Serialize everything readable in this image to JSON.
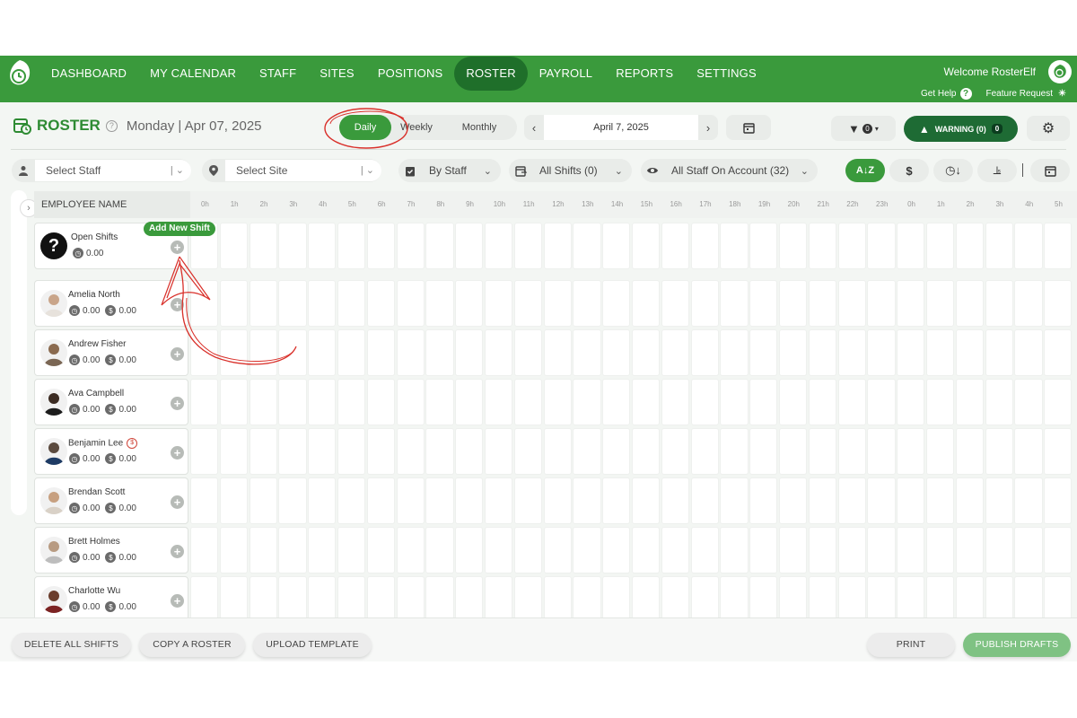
{
  "nav": {
    "items": [
      "DASHBOARD",
      "MY CALENDAR",
      "STAFF",
      "SITES",
      "POSITIONS",
      "ROSTER",
      "PAYROLL",
      "REPORTS",
      "SETTINGS"
    ],
    "active": "ROSTER",
    "welcome": "Welcome RosterElf",
    "get_help": "Get Help",
    "feature_request": "Feature Request"
  },
  "header": {
    "title": "ROSTER",
    "date": "Monday | Apr 07, 2025",
    "views": [
      "Daily",
      "Weekly",
      "Monthly"
    ],
    "active_view": "Daily",
    "selected_date": "April 7, 2025",
    "filter_count": "0",
    "warning_label": "WARNING (0)",
    "warning_count": "0"
  },
  "filters": {
    "staff_placeholder": "Select Staff",
    "site_placeholder": "Select Site",
    "group_by": "By Staff",
    "shifts": "All Shifts (0)",
    "visibility": "All Staff On Account (32)"
  },
  "grid": {
    "employee_header": "EMPLOYEE NAME",
    "hours": [
      "0h",
      "1h",
      "2h",
      "3h",
      "4h",
      "5h",
      "6h",
      "7h",
      "8h",
      "9h",
      "10h",
      "11h",
      "12h",
      "13h",
      "14h",
      "15h",
      "16h",
      "17h",
      "18h",
      "19h",
      "20h",
      "21h",
      "22h",
      "23h",
      "0h",
      "1h",
      "2h",
      "3h",
      "4h",
      "5h"
    ],
    "add_new_shift": "Add New Shift",
    "open_shifts": {
      "name": "Open Shifts",
      "hours": "0.00"
    },
    "employees": [
      {
        "name": "Amelia North",
        "hours": "0.00",
        "cost": "0.00"
      },
      {
        "name": "Andrew Fisher",
        "hours": "0.00",
        "cost": "0.00"
      },
      {
        "name": "Ava Campbell",
        "hours": "0.00",
        "cost": "0.00"
      },
      {
        "name": "Benjamin Lee",
        "hours": "0.00",
        "cost": "0.00"
      },
      {
        "name": "Brendan Scott",
        "hours": "0.00",
        "cost": "0.00"
      },
      {
        "name": "Brett Holmes",
        "hours": "0.00",
        "cost": "0.00"
      },
      {
        "name": "Charlotte Wu",
        "hours": "0.00",
        "cost": "0.00"
      }
    ]
  },
  "bottom": {
    "delete_all": "DELETE ALL SHIFTS",
    "copy": "COPY A ROSTER",
    "upload": "UPLOAD TEMPLATE",
    "print": "PRINT",
    "publish": "PUBLISH DRAFTS"
  },
  "colors": {
    "brand": "#3a9a3c",
    "dark": "#1e6b34",
    "annotation": "#d9302a"
  }
}
